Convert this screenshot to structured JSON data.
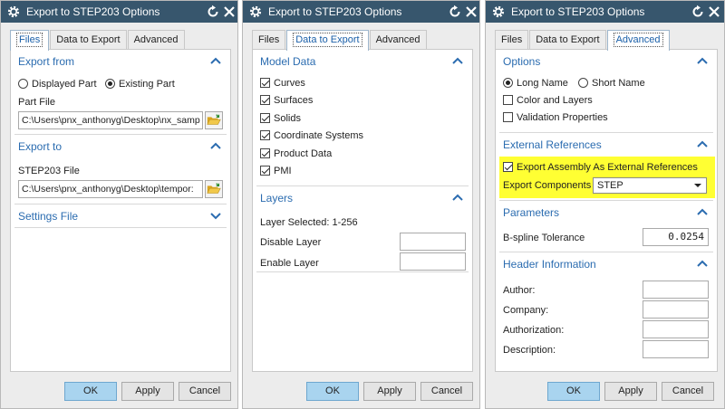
{
  "dialog_title": "Export to STEP203 Options",
  "tabs": [
    "Files",
    "Data to Export",
    "Advanced"
  ],
  "buttons": {
    "ok": "OK",
    "apply": "Apply",
    "cancel": "Cancel"
  },
  "files_tab": {
    "export_from": {
      "title": "Export from",
      "option_displayed": "Displayed Part",
      "option_existing": "Existing Part",
      "selected": "Existing Part",
      "part_file_label": "Part File",
      "part_file_value": "C:\\Users\\pnx_anthonyg\\Desktop\\nx_samp"
    },
    "export_to": {
      "title": "Export to",
      "file_label": "STEP203 File",
      "file_value": "C:\\Users\\pnx_anthonyg\\Desktop\\tempor:"
    },
    "settings_file": {
      "title": "Settings File"
    }
  },
  "data_tab": {
    "model_data": {
      "title": "Model Data",
      "items": [
        {
          "label": "Curves",
          "checked": true
        },
        {
          "label": "Surfaces",
          "checked": true
        },
        {
          "label": "Solids",
          "checked": true
        },
        {
          "label": "Coordinate Systems",
          "checked": true
        },
        {
          "label": "Product Data",
          "checked": true
        },
        {
          "label": "PMI",
          "checked": true
        }
      ]
    },
    "layers": {
      "title": "Layers",
      "layer_selected": "Layer Selected: 1-256",
      "disable_label": "Disable Layer",
      "disable_value": "",
      "enable_label": "Enable Layer",
      "enable_value": ""
    }
  },
  "advanced_tab": {
    "options": {
      "title": "Options",
      "long_name": "Long Name",
      "short_name": "Short Name",
      "selected": "Long Name",
      "color_layers": "Color and Layers",
      "color_layers_checked": false,
      "validation": "Validation Properties",
      "validation_checked": false
    },
    "external_refs": {
      "title": "External References",
      "export_assembly": "Export Assembly As External References",
      "export_assembly_checked": true,
      "export_components_label": "Export Components .",
      "export_components_value": "STEP",
      "highlight_color": "#ffff33"
    },
    "parameters": {
      "title": "Parameters",
      "bspline_label": "B-spline Tolerance",
      "bspline_value": "0.0254"
    },
    "header_info": {
      "title": "Header Information",
      "author_label": "Author:",
      "company_label": "Company:",
      "authorization_label": "Authorization:",
      "description_label": "Description:"
    }
  },
  "colors": {
    "titlebar": "#37566d",
    "section_title": "#2b6cb0",
    "ok_button": "#a9d4ef"
  }
}
